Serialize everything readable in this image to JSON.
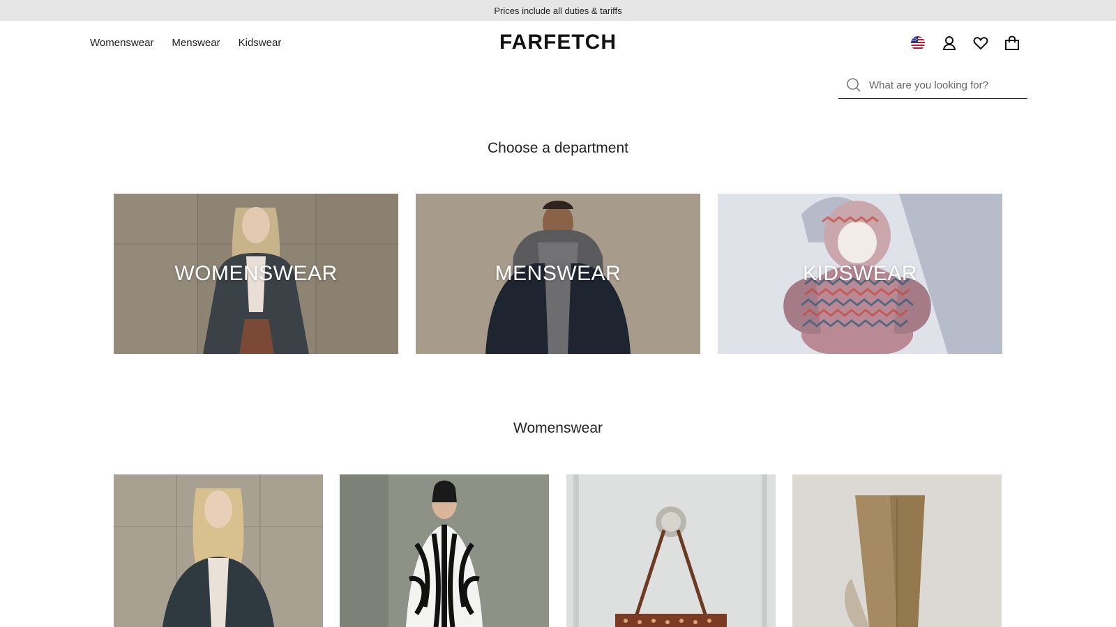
{
  "promo": {
    "text": "Prices include all duties & tariffs"
  },
  "header": {
    "nav": [
      "Womenswear",
      "Menswear",
      "Kidswear"
    ],
    "logo": "FARFETCH",
    "icons": [
      "us-flag-icon",
      "account-icon",
      "wishlist-heart-icon",
      "shopping-bag-icon"
    ]
  },
  "search": {
    "placeholder": "What are you looking for?"
  },
  "departments": {
    "title": "Choose a department",
    "cards": [
      {
        "label": "WOMENSWEAR"
      },
      {
        "label": "MENSWEAR"
      },
      {
        "label": "KIDSWEAR"
      }
    ]
  },
  "womenswear": {
    "title": "Womenswear"
  },
  "colors": {
    "promo_bg": "#e6e6e6",
    "text": "#222222",
    "card_text": "#ffffff"
  }
}
